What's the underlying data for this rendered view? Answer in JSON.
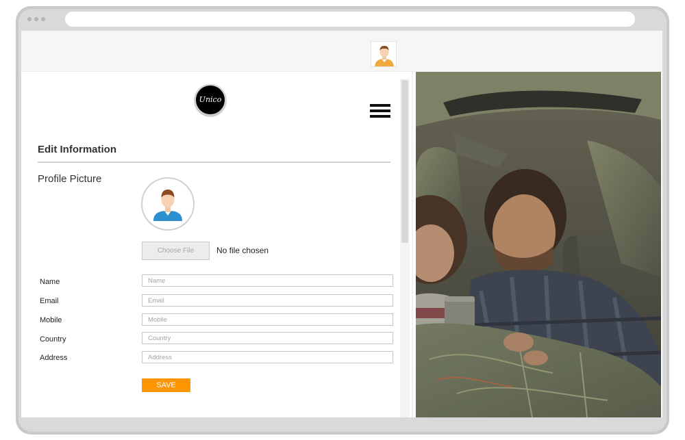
{
  "logo": {
    "text": "Unico"
  },
  "form": {
    "title": "Edit Information",
    "profile_picture_label": "Profile Picture",
    "choose_file_label": "Choose File",
    "no_file_text": "No file chosen",
    "fields": [
      {
        "label": "Name",
        "placeholder": "Name",
        "value": ""
      },
      {
        "label": "Email",
        "placeholder": "Email",
        "value": ""
      },
      {
        "label": "Mobile",
        "placeholder": "Mobile",
        "value": ""
      },
      {
        "label": "Country",
        "placeholder": "Country",
        "value": ""
      },
      {
        "label": "Address",
        "placeholder": "Address",
        "value": ""
      }
    ],
    "save_label": "SAVE"
  },
  "colors": {
    "accent": "#ff9500",
    "avatar_shirt": "#2e8fcf",
    "topbar_avatar_shirt": "#f2a93b",
    "hero_overlay": "#3d3f38"
  },
  "icons": {
    "menu": "hamburger-menu-icon",
    "profile": "user-avatar-icon"
  }
}
